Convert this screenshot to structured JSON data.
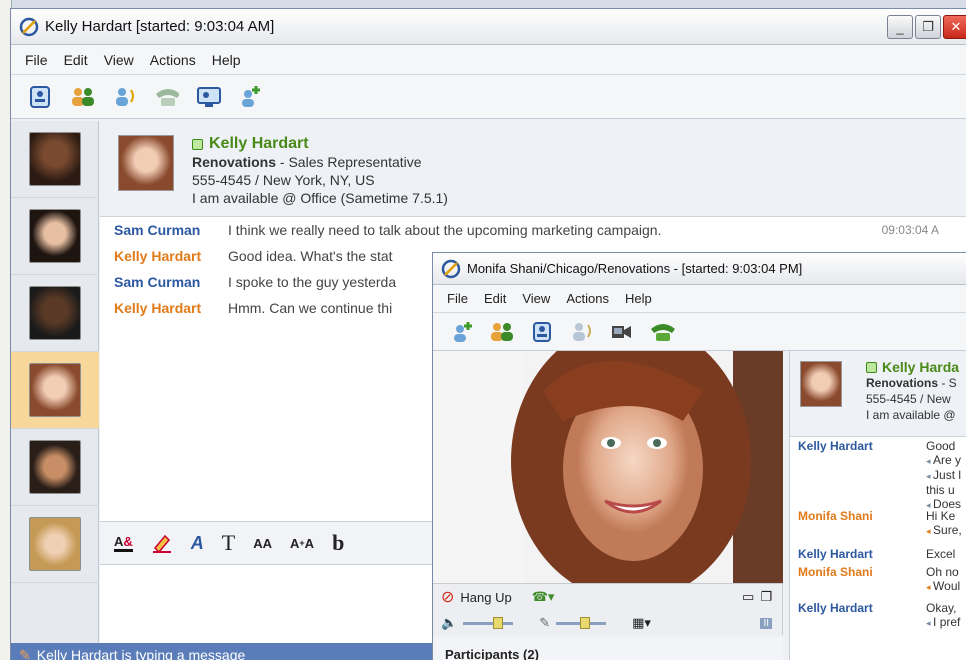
{
  "main_window": {
    "title": "Kelly Hardart [started: 9:03:04 AM]",
    "menu": [
      "File",
      "Edit",
      "View",
      "Actions",
      "Help"
    ],
    "toolbar_icons": [
      "contact-card-icon",
      "group-icon",
      "audio-call-icon",
      "phone-icon",
      "screen-share-icon",
      "add-person-icon"
    ],
    "contact": {
      "name": "Kelly Hardart",
      "company": "Renovations",
      "role": " - Sales Representative",
      "phone_location": "555-4545 / New York, NY, US",
      "status_message": "I am available @ Office (Sametime 7.5.1)"
    },
    "messages": [
      {
        "who": "Sam Curman",
        "text": "I think we really need to talk about the upcoming marketing campaign.",
        "time": "09:03:04 A"
      },
      {
        "who": "Kelly Hardart",
        "text": "Good idea. What's the stat",
        "time": ""
      },
      {
        "who": "Sam Curman",
        "text": "I spoke to the guy yesterda",
        "time": ""
      },
      {
        "who": "Kelly Hardart",
        "text": "Hmm. Can we continue thi",
        "time": ""
      }
    ],
    "format_tools": [
      "A&",
      "",
      "A",
      "T",
      "AA",
      "A+A",
      "b"
    ],
    "status_bar": "Kelly Hardart is typing a message"
  },
  "second_window": {
    "title": "Monifa Shani/Chicago/Renovations - [started: 9:03:04 PM]",
    "menu": [
      "File",
      "Edit",
      "View",
      "Actions",
      "Help"
    ],
    "hang_up": "Hang Up",
    "participants": "Participants (2)",
    "contact": {
      "name": "Kelly Harda",
      "company": "Renovations",
      "company_suffix": " - S",
      "phone": "555-4545 / New",
      "status": "I am available @"
    },
    "messages": [
      {
        "who": "Kelly Hardart",
        "lines": [
          "Good",
          "Are y",
          "Just l",
          "this u",
          "Does"
        ]
      },
      {
        "who": "Monifa Shani",
        "lines": [
          "Hi Ke",
          "Sure,"
        ]
      },
      {
        "who": "Kelly Hardart",
        "lines": [
          "Excel"
        ]
      },
      {
        "who": "Monifa Shani",
        "lines": [
          "Oh no",
          "Woul"
        ]
      },
      {
        "who": "Kelly Hardart",
        "lines": [
          "Okay,",
          "I pref"
        ]
      }
    ]
  },
  "colors": {
    "accent_green": "#4a8a18",
    "sam_blue": "#2c58a0",
    "kelly_orange": "#e17a18",
    "statusbar": "#5a7cb8"
  }
}
